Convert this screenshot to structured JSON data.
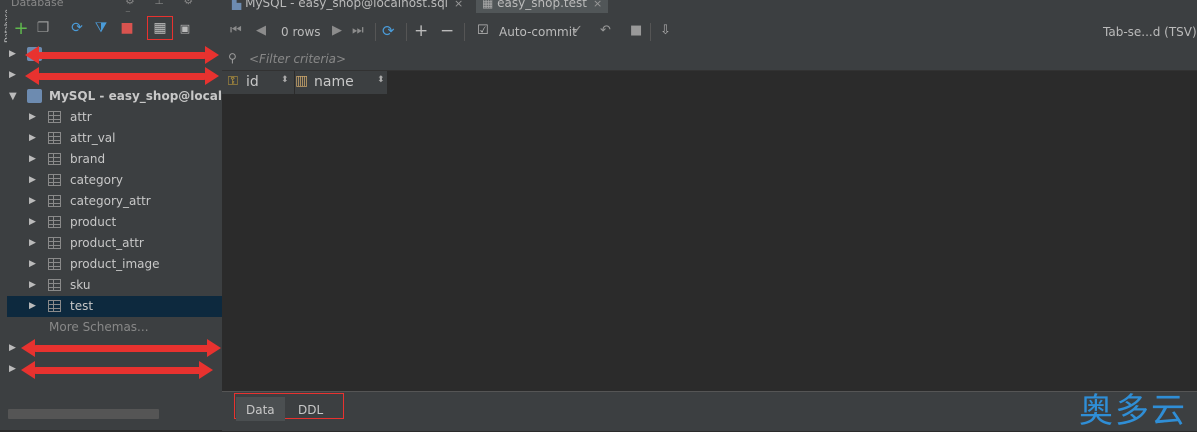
{
  "left_panel": {
    "title": "Database",
    "toolbar_icons": [
      "add-icon",
      "copy-icon",
      "refresh-icon",
      "filter-icon",
      "stop-icon",
      "table-view-icon",
      "console-icon"
    ],
    "datasources": [
      {
        "label": "",
        "obscured": true
      },
      {
        "label": "",
        "obscured": true
      }
    ],
    "active_datasource": "MySQL - easy_shop@localhost",
    "tables": [
      "attr",
      "attr_val",
      "brand",
      "category",
      "category_attr",
      "product",
      "product_attr",
      "product_image",
      "sku",
      "test"
    ],
    "selected_table": "test",
    "more_schemas": "More Schemas...",
    "trailing_datasources": [
      {
        "label": "",
        "obscured": true
      },
      {
        "label": "",
        "obscured": true
      }
    ]
  },
  "tabs": [
    {
      "label": "MySQL - easy_shop@localhost.sql",
      "close": "×"
    },
    {
      "label": "easy_shop.test",
      "close": "×",
      "active": true
    }
  ],
  "toolbar": {
    "rows": "0 rows",
    "auto_commit": "Auto-commit",
    "export_format": "Tab-se...d (TSV)"
  },
  "filter": {
    "placeholder": "<Filter criteria>"
  },
  "columns": [
    {
      "name": "id",
      "icon": "key-column-icon"
    },
    {
      "name": "name",
      "icon": "column-icon"
    }
  ],
  "bottom_tabs": [
    "Data",
    "DDL"
  ],
  "watermark": "奥多云",
  "colors": {
    "accent_red": "#e8322f",
    "selection": "#0d293e",
    "watermark_blue": "#2f8ed6"
  }
}
